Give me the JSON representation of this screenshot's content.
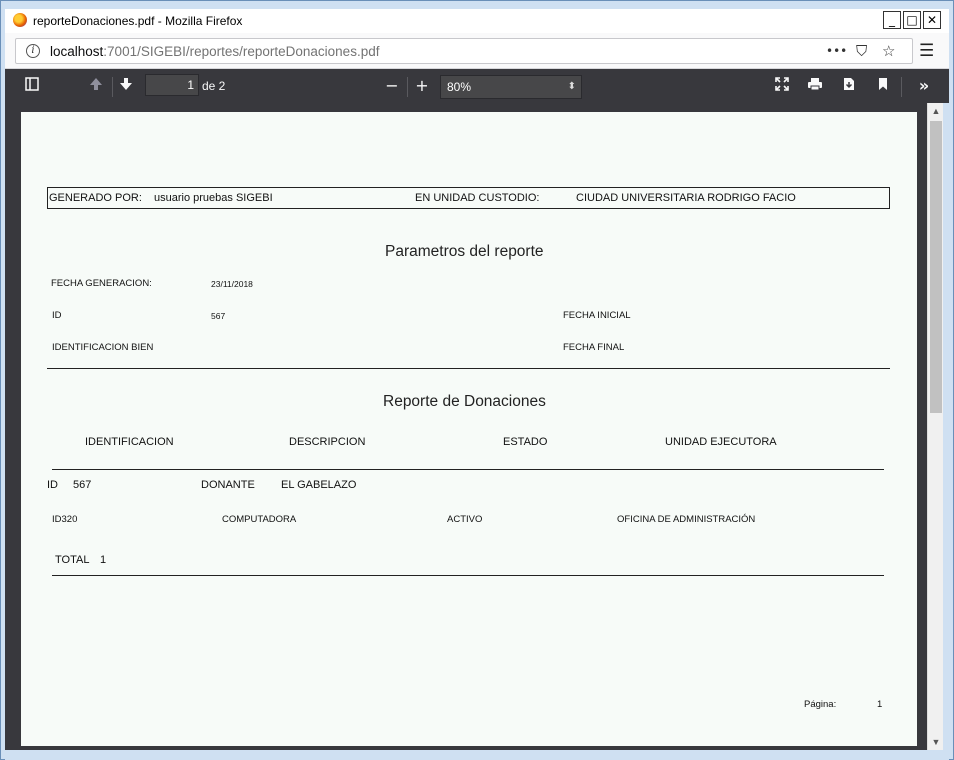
{
  "window": {
    "title": "reporteDonaciones.pdf - Mozilla Firefox",
    "buttons": {
      "minimize": "_",
      "maximize": "□",
      "close": "✕"
    }
  },
  "urlbar": {
    "host": "localhost",
    "path": ":7001/SIGEBI/reportes/reporteDonaciones.pdf",
    "more_icon": "•••",
    "pocket_icon": "⛉",
    "bookmark_icon": "☆",
    "menu_icon": "☰"
  },
  "pdf_toolbar": {
    "current_page": "1",
    "page_count": "de 2",
    "zoom": "80%"
  },
  "report": {
    "generated_by_label": "GENERADO POR:",
    "generated_by_value": "usuario pruebas SIGEBI",
    "unit_label": "EN UNIDAD CUSTODIO:",
    "unit_value": "CIUDAD UNIVERSITARIA RODRIGO FACIO",
    "params_title": "Parametros del reporte",
    "fecha_generacion_label": "FECHA GENERACION:",
    "fecha_generacion_value": "23/11/2018",
    "id_label": "ID",
    "id_value": "567",
    "fecha_inicial_label": "FECHA INICIAL",
    "identificacion_bien_label": "IDENTIFICACION BIEN",
    "fecha_final_label": "FECHA FINAL",
    "report_title": "Reporte de Donaciones",
    "columns": [
      "IDENTIFICACION",
      "DESCRIPCION",
      "ESTADO",
      "UNIDAD EJECUTORA"
    ],
    "group": {
      "id_label": "ID",
      "id_value": "567",
      "donante_label": "DONANTE",
      "donante_value": "EL GABELAZO"
    },
    "rows": [
      {
        "identificacion": "ID320",
        "descripcion": "COMPUTADORA",
        "estado": "ACTIVO",
        "unidad": "OFICINA DE ADMINISTRACIÓN"
      }
    ],
    "total_label": "TOTAL",
    "total_value": "1",
    "page_label": "Página:",
    "page_value": "1"
  }
}
